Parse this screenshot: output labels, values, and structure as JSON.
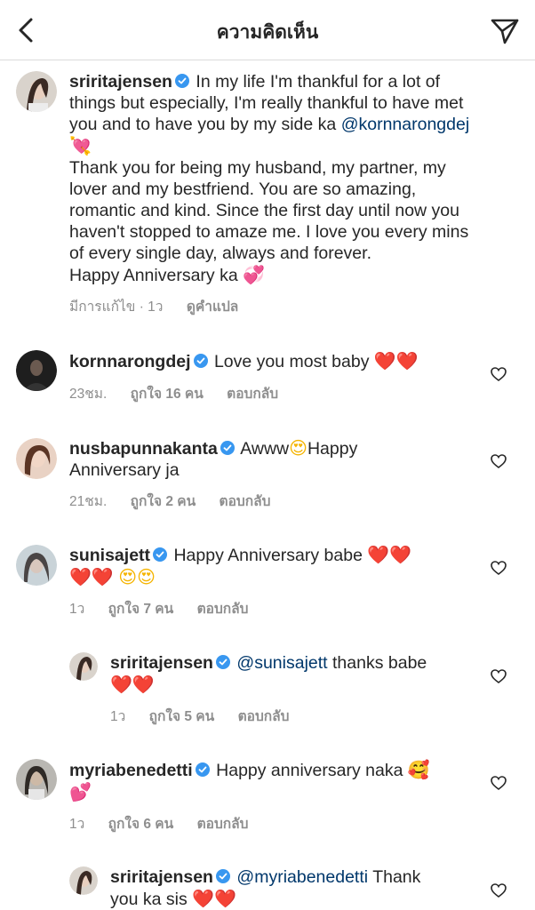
{
  "header": {
    "title": "ความคิดเห็น",
    "back_icon": "chevron-left-icon",
    "share_icon": "paper-plane-icon"
  },
  "caption": {
    "username": "sriritajensen",
    "line1": "In my life I'm thankful for a lot of",
    "line2": "things but especially, I'm really thankful to have met",
    "line3a": "you and to have you by my side ka",
    "mention": "@kornnarongdej",
    "heart_emoji": "💘",
    "line4": "Thank you for being my husband, my partner, my",
    "line5": "lover and my bestfriend.  You are so amazing,",
    "line6": "romantic and kind. Since the first day until now you",
    "line7": "haven't stopped to amaze me. I love you every mins",
    "line8": "of every single day, always and forever.",
    "line9": "Happy Anniversary ka",
    "heart2_emoji": "💞",
    "edited": "มีการแก้ไข · 1ว",
    "translate": "ดูคำแปล"
  },
  "comments": [
    {
      "username": "kornnarongdej",
      "text": "Love you most baby",
      "emoji": "❤️❤️",
      "time": "23ชม.",
      "likes": "ถูกใจ 16 คน",
      "reply": "ตอบกลับ"
    },
    {
      "username": "nusbapunnakanta",
      "text_a": "Awww",
      "emoji": "😍",
      "text_b": "Happy",
      "text_c": "Anniversary ja",
      "time": "21ชม.",
      "likes": "ถูกใจ 2 คน",
      "reply": "ตอบกลับ"
    },
    {
      "username": "sunisajett",
      "text": "Happy Anniversary babe",
      "emoji_a": "❤️❤️",
      "emoji_b": "❤️❤️",
      "emoji_c": "😍😍",
      "time": "1ว",
      "likes": "ถูกใจ 7 คน",
      "reply": "ตอบกลับ"
    },
    {
      "username": "sriritajensen",
      "mention": "@sunisajett",
      "text": "thanks babe",
      "emoji": "❤️❤️",
      "time": "1ว",
      "likes": "ถูกใจ 5 คน",
      "reply": "ตอบกลับ"
    },
    {
      "username": "myriabenedetti",
      "text": "Happy anniversary naka",
      "emoji_a": "🥰",
      "emoji_b": "💕",
      "time": "1ว",
      "likes": "ถูกใจ 6 คน",
      "reply": "ตอบกลับ"
    },
    {
      "username": "sriritajensen",
      "mention": "@myriabenedetti",
      "text_a": "Thank",
      "text_b": "you ka sis",
      "emoji": "❤️❤️"
    }
  ],
  "colors": {
    "text": "#262626",
    "secondary": "#8e8e8e",
    "mention": "#00376b",
    "verified": "#3897f0",
    "divider": "#dbdbdb"
  }
}
